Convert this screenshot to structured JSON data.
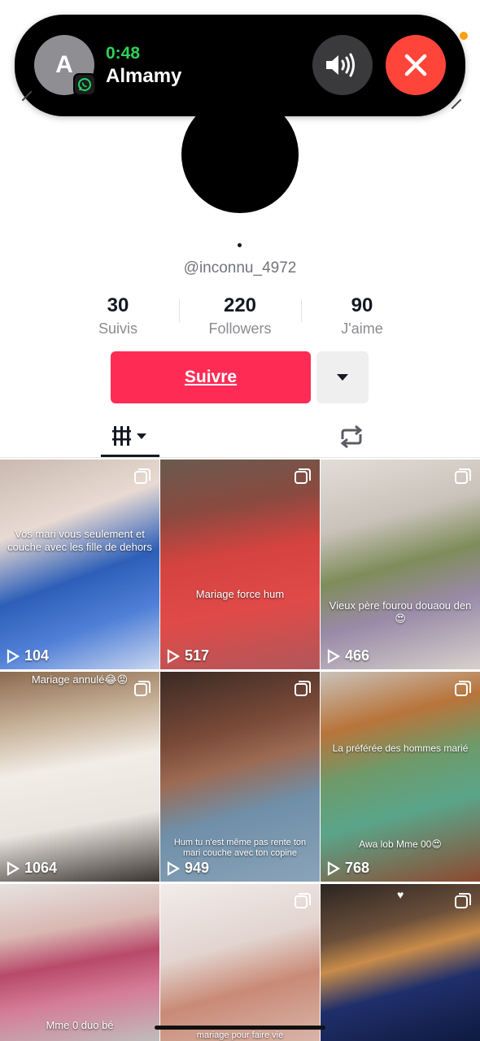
{
  "call": {
    "avatar_letter": "A",
    "timer": "0:48",
    "name": "Almamy",
    "icons": [
      "whatsapp-icon",
      "speaker-icon",
      "end-call-icon"
    ],
    "accent_timer": "#30d158",
    "end_color": "#ff453a"
  },
  "profile": {
    "username": "@inconnu_4972",
    "stats": [
      {
        "value": "30",
        "label": "Suivis"
      },
      {
        "value": "220",
        "label": "Followers"
      },
      {
        "value": "90",
        "label": "J'aime"
      }
    ],
    "follow_label": "Suivre",
    "follow_color": "#fe2c55"
  },
  "tabs": {
    "videos_icon": "grid-icon",
    "reposts_icon": "repost-icon"
  },
  "videos": [
    {
      "caption": "Vos mari vous seulement et couche avec les fille de dehors",
      "views": "104"
    },
    {
      "caption": "Mariage force hum",
      "views": "517"
    },
    {
      "caption": "Vieux père fourou douaou den😍",
      "views": "466"
    },
    {
      "caption": "Mariage annulé😂😡",
      "views": "1064"
    },
    {
      "caption": "Hum tu n'est même pas rente ton mari couche avec ton copine",
      "views": "949"
    },
    {
      "caption": "La préférée des hommes marié",
      "views": "768",
      "caption2": "Awa lob Mme 00😍"
    },
    {
      "caption": "Mme 0 duo bé",
      "views": ""
    },
    {
      "caption": "mariage pour faire vie",
      "views": ""
    },
    {
      "caption": "",
      "views": ""
    }
  ]
}
